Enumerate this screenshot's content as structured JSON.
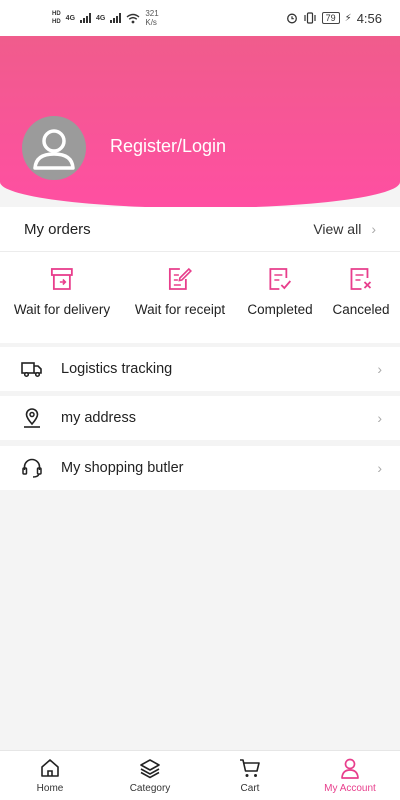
{
  "status_bar": {
    "sim1": "4G",
    "sim2": "4G",
    "speed_value": "321",
    "speed_unit": "K/s",
    "battery": "79",
    "time": "4:56"
  },
  "header": {
    "login_label": "Register/Login"
  },
  "orders": {
    "title": "My orders",
    "view_all_label": "View all",
    "statuses": [
      {
        "label": "Wait for delivery",
        "icon": "box-icon"
      },
      {
        "label": "Wait for receipt",
        "icon": "edit-document-icon"
      },
      {
        "label": "Completed",
        "icon": "completed-document-icon"
      },
      {
        "label": "Canceled",
        "icon": "canceled-document-icon"
      }
    ]
  },
  "menu": [
    {
      "label": "Logistics tracking",
      "icon": "truck-icon"
    },
    {
      "label": "my address",
      "icon": "location-pin-icon"
    },
    {
      "label": "My shopping butler",
      "icon": "headset-icon"
    }
  ],
  "bottom_nav": {
    "items": [
      {
        "label": "Home",
        "icon": "home-icon"
      },
      {
        "label": "Category",
        "icon": "layers-icon"
      },
      {
        "label": "Cart",
        "icon": "cart-icon"
      },
      {
        "label": "My Account",
        "icon": "user-icon",
        "active": true
      }
    ]
  },
  "colors": {
    "accent": "#e83e8c",
    "header_top": "#f05c8c",
    "header_bottom": "#ff4fa2",
    "page_bg": "#f4f4f4"
  }
}
